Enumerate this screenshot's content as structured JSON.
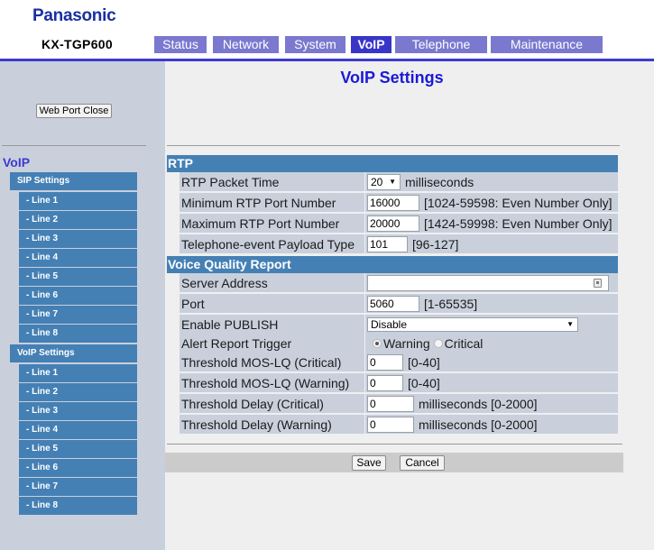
{
  "header": {
    "brand": "Panasonic",
    "model": "KX-TGP600",
    "tabs": [
      {
        "label": "Status",
        "active": false
      },
      {
        "label": "Network",
        "active": false
      },
      {
        "label": "System",
        "active": false
      },
      {
        "label": "VoIP",
        "active": true
      },
      {
        "label": "Telephone",
        "active": false
      },
      {
        "label": "Maintenance",
        "active": false
      }
    ]
  },
  "sidebar": {
    "web_port_close_label": "Web Port Close",
    "heading": "VoIP",
    "sip_settings": {
      "label": "SIP Settings",
      "lines": [
        "- Line 1",
        "- Line 2",
        "- Line 3",
        "- Line 4",
        "- Line 5",
        "- Line 6",
        "- Line 7",
        "- Line 8"
      ]
    },
    "voip_settings": {
      "label": "VoIP Settings",
      "lines": [
        "- Line 1",
        "- Line 2",
        "- Line 3",
        "- Line 4",
        "- Line 5",
        "- Line 6",
        "- Line 7",
        "- Line 8"
      ]
    }
  },
  "main": {
    "title": "VoIP Settings",
    "rtp": {
      "header": "RTP",
      "packet_time": {
        "label": "RTP Packet Time",
        "value": "20",
        "unit": "milliseconds"
      },
      "min_port": {
        "label": "Minimum RTP Port Number",
        "value": "16000",
        "hint": "[1024-59598: Even Number Only]"
      },
      "max_port": {
        "label": "Maximum RTP Port Number",
        "value": "20000",
        "hint": "[1424-59998: Even Number Only]"
      },
      "payload_type": {
        "label": "Telephone-event Payload Type",
        "value": "101",
        "hint": "[96-127]"
      }
    },
    "vqr": {
      "header": "Voice Quality Report",
      "server_address": {
        "label": "Server Address",
        "value": ""
      },
      "port": {
        "label": "Port",
        "value": "5060",
        "hint": "[1-65535]"
      },
      "enable_publish": {
        "label": "Enable PUBLISH",
        "value": "Disable"
      },
      "alert_trigger": {
        "label": "Alert Report Trigger",
        "options": [
          "Warning",
          "Critical"
        ],
        "selected": "Warning"
      },
      "mos_critical": {
        "label": "Threshold MOS-LQ (Critical)",
        "value": "0",
        "hint": "[0-40]"
      },
      "mos_warning": {
        "label": "Threshold MOS-LQ (Warning)",
        "value": "0",
        "hint": "[0-40]"
      },
      "delay_critical": {
        "label": "Threshold Delay (Critical)",
        "value": "0",
        "hint": "milliseconds [0-2000]"
      },
      "delay_warning": {
        "label": "Threshold Delay (Warning)",
        "value": "0",
        "hint": "milliseconds [0-2000]"
      }
    },
    "buttons": {
      "save": "Save",
      "cancel": "Cancel"
    }
  }
}
